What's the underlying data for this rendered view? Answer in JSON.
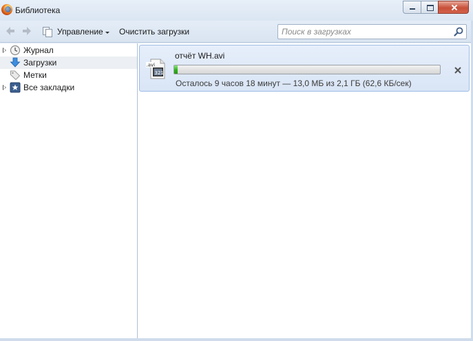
{
  "window": {
    "title": "Библиотека"
  },
  "toolbar": {
    "manage_label": "Управление",
    "clear_label": "Очистить загрузки",
    "search_placeholder": "Поиск в загрузках"
  },
  "sidebar": {
    "items": [
      {
        "label": "Журнал",
        "icon": "history-clock-icon",
        "expandable": true,
        "selected": false
      },
      {
        "label": "Загрузки",
        "icon": "download-arrow-icon",
        "expandable": false,
        "selected": true
      },
      {
        "label": "Метки",
        "icon": "tags-icon",
        "expandable": false,
        "selected": false
      },
      {
        "label": "Все закладки",
        "icon": "bookmarks-star-icon",
        "expandable": true,
        "selected": false
      }
    ]
  },
  "downloads": [
    {
      "file_name": "отчёт WH.avi",
      "file_icon": "avi-video-file-icon",
      "progress_fraction": 0.006,
      "status": "Осталось 9 часов 18 минут — 13,0 МБ из 2,1 ГБ (62,6 КБ/сек)"
    }
  ],
  "colors": {
    "progress_green": "#2fb11a",
    "selection_blue": "#d9e5f6",
    "close_red": "#c8503a"
  }
}
